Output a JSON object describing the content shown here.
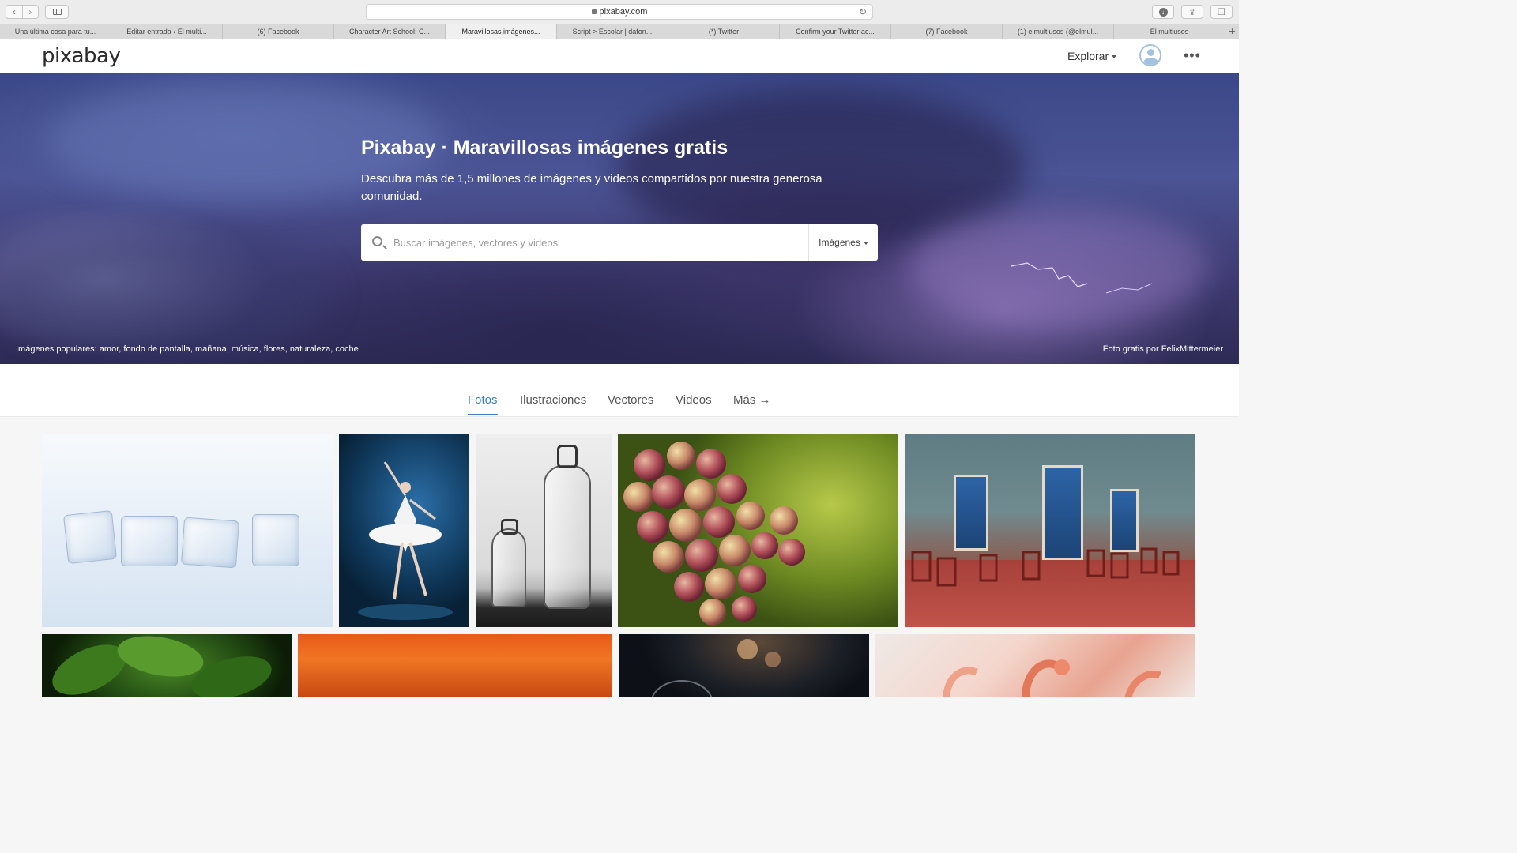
{
  "browser": {
    "url": "pixabay.com",
    "tabs": [
      {
        "label": "Una última cosa para tu..."
      },
      {
        "label": "Editar entrada ‹ El multi..."
      },
      {
        "label": "(6) Facebook"
      },
      {
        "label": "Character Art School: C..."
      },
      {
        "label": "Maravillosas imágenes...",
        "active": true
      },
      {
        "label": "Script > Escolar | dafon..."
      },
      {
        "label": "(*) Twitter"
      },
      {
        "label": "Confirm your Twitter ac..."
      },
      {
        "label": "(7) Facebook"
      },
      {
        "label": "(1) elmultiusos (@elmul..."
      },
      {
        "label": "El multiusos"
      }
    ]
  },
  "header": {
    "logo": "pixabay",
    "explore_label": "Explorar",
    "avatar_icon": "user-icon",
    "more_icon": "more-horizontal-icon"
  },
  "hero": {
    "title": "Pixabay · Maravillosas imágenes gratis",
    "subtitle": "Descubra más de 1,5 millones de imágenes y videos compartidos por nuestra generosa comunidad.",
    "search_placeholder": "Buscar imágenes, vectores y videos",
    "search_type": "Imágenes",
    "popular_prefix": "Imágenes populares:",
    "popular_tags": [
      "amor",
      "fondo de pantalla",
      "mañana",
      "música",
      "flores",
      "naturaleza",
      "coche"
    ],
    "credit": "Foto gratis por FelixMittermeier"
  },
  "categories": [
    {
      "label": "Fotos",
      "active": true
    },
    {
      "label": "Ilustraciones"
    },
    {
      "label": "Vectores"
    },
    {
      "label": "Videos"
    },
    {
      "label": "Más →"
    }
  ],
  "gallery": {
    "row1": [
      "ice-cubes",
      "ballerina",
      "bottles",
      "grapes",
      "cafe-facade"
    ],
    "row2": [
      "basil",
      "orange-sky",
      "bokeh-glass",
      "flamingos"
    ]
  },
  "colors": {
    "accent": "#3d7fc1",
    "hero_dark": "#2d2a55"
  }
}
